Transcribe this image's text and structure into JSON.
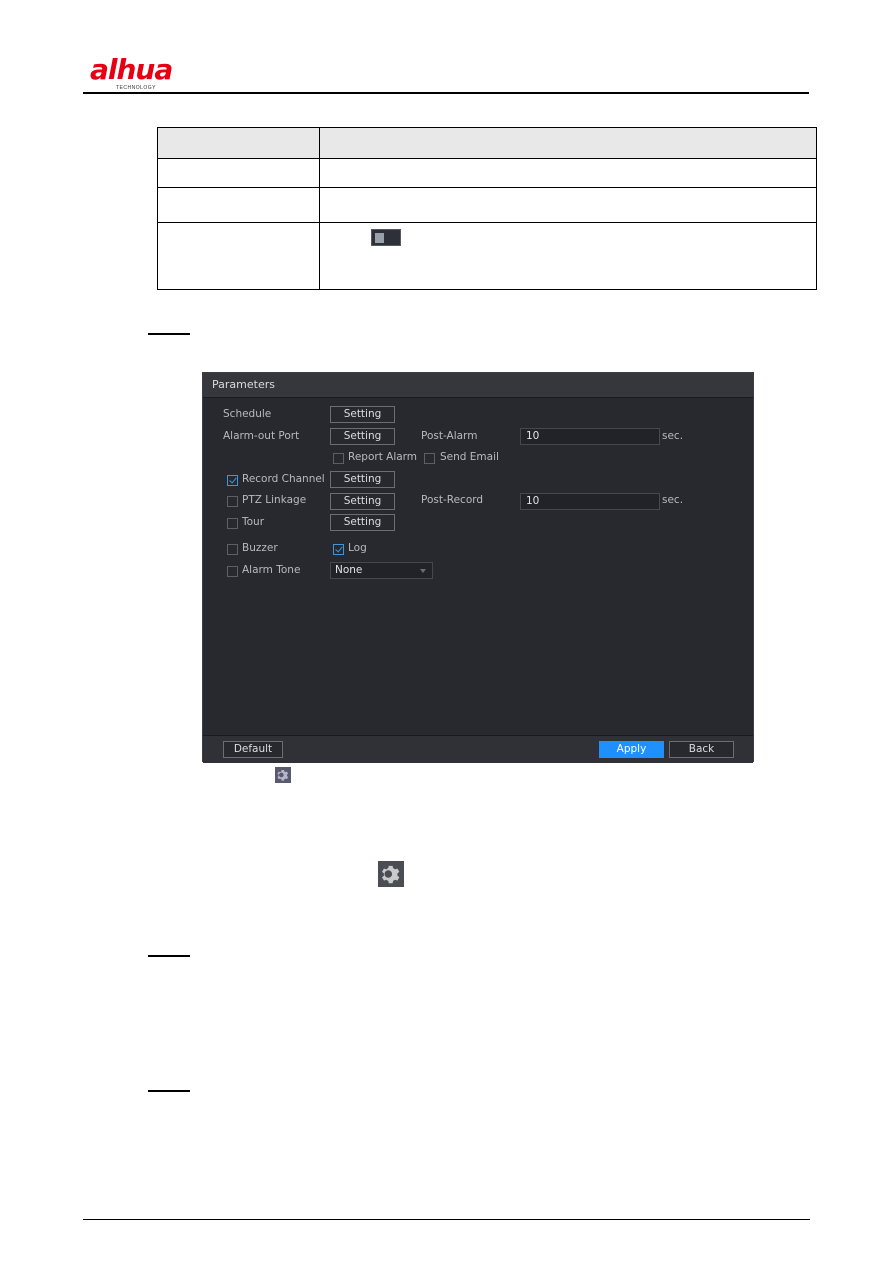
{
  "header": {
    "brand": "alhua",
    "brand_tagline": "TECHNOLOGY"
  },
  "table": {
    "rows": 4,
    "toggle_state": "off"
  },
  "dialog": {
    "title": "Parameters",
    "rows": {
      "schedule": {
        "label": "Schedule",
        "button": "Setting"
      },
      "alarm_out_port": {
        "label": "Alarm-out Port",
        "button": "Setting",
        "post_label": "Post-Alarm",
        "post_value": "10",
        "unit": "sec."
      },
      "report_alarm": {
        "label": "Report Alarm",
        "checked": false
      },
      "send_email": {
        "label": "Send Email",
        "checked": false
      },
      "record_channel": {
        "label": "Record Channel",
        "checked": true,
        "button": "Setting"
      },
      "ptz_linkage": {
        "label": "PTZ Linkage",
        "checked": false,
        "button": "Setting",
        "post_label": "Post-Record",
        "post_value": "10",
        "unit": "sec."
      },
      "tour": {
        "label": "Tour",
        "checked": false,
        "button": "Setting"
      },
      "buzzer": {
        "label": "Buzzer",
        "checked": false
      },
      "log": {
        "label": "Log",
        "checked": true
      },
      "alarm_tone": {
        "label": "Alarm Tone",
        "checked": false,
        "selected": "None"
      }
    },
    "footer": {
      "default_label": "Default",
      "apply_label": "Apply",
      "back_label": "Back"
    }
  },
  "icons": {
    "inline_gear_small": "gear-icon",
    "inline_gear_large": "gear-icon"
  },
  "colors": {
    "brand_red": "#e60012",
    "apply_blue": "#1e90ff",
    "dialog_bg": "#27292e",
    "checkbox_accent": "#3c97d8"
  }
}
